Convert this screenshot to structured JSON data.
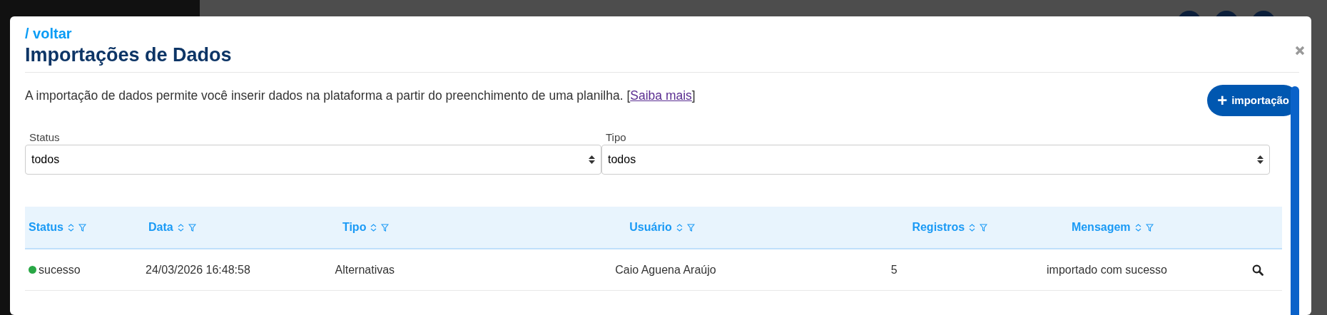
{
  "back_link": "/ voltar",
  "title": "Importações de Dados",
  "description": {
    "text": "A importação de dados permite você inserir dados na plataforma a partir do preenchimento de uma planilha. [",
    "link": "Saiba mais",
    "after": "]"
  },
  "add_button": {
    "icon": "+",
    "label": "importação"
  },
  "filters": [
    {
      "label": "Status",
      "value": "todos"
    },
    {
      "label": "Tipo",
      "value": "todos"
    }
  ],
  "table": {
    "columns": [
      {
        "label": "Status"
      },
      {
        "label": "Data"
      },
      {
        "label": "Tipo"
      },
      {
        "label": "Usuário"
      },
      {
        "label": "Registros"
      },
      {
        "label": "Mensagem"
      }
    ],
    "rows": [
      {
        "status": "sucesso",
        "color": "#28a745",
        "date": "24/03/2026 16:48:58",
        "type": "Alternativas",
        "user": "Caio Aguena Araújo",
        "records": "5",
        "message": "importado com sucesso"
      }
    ]
  }
}
